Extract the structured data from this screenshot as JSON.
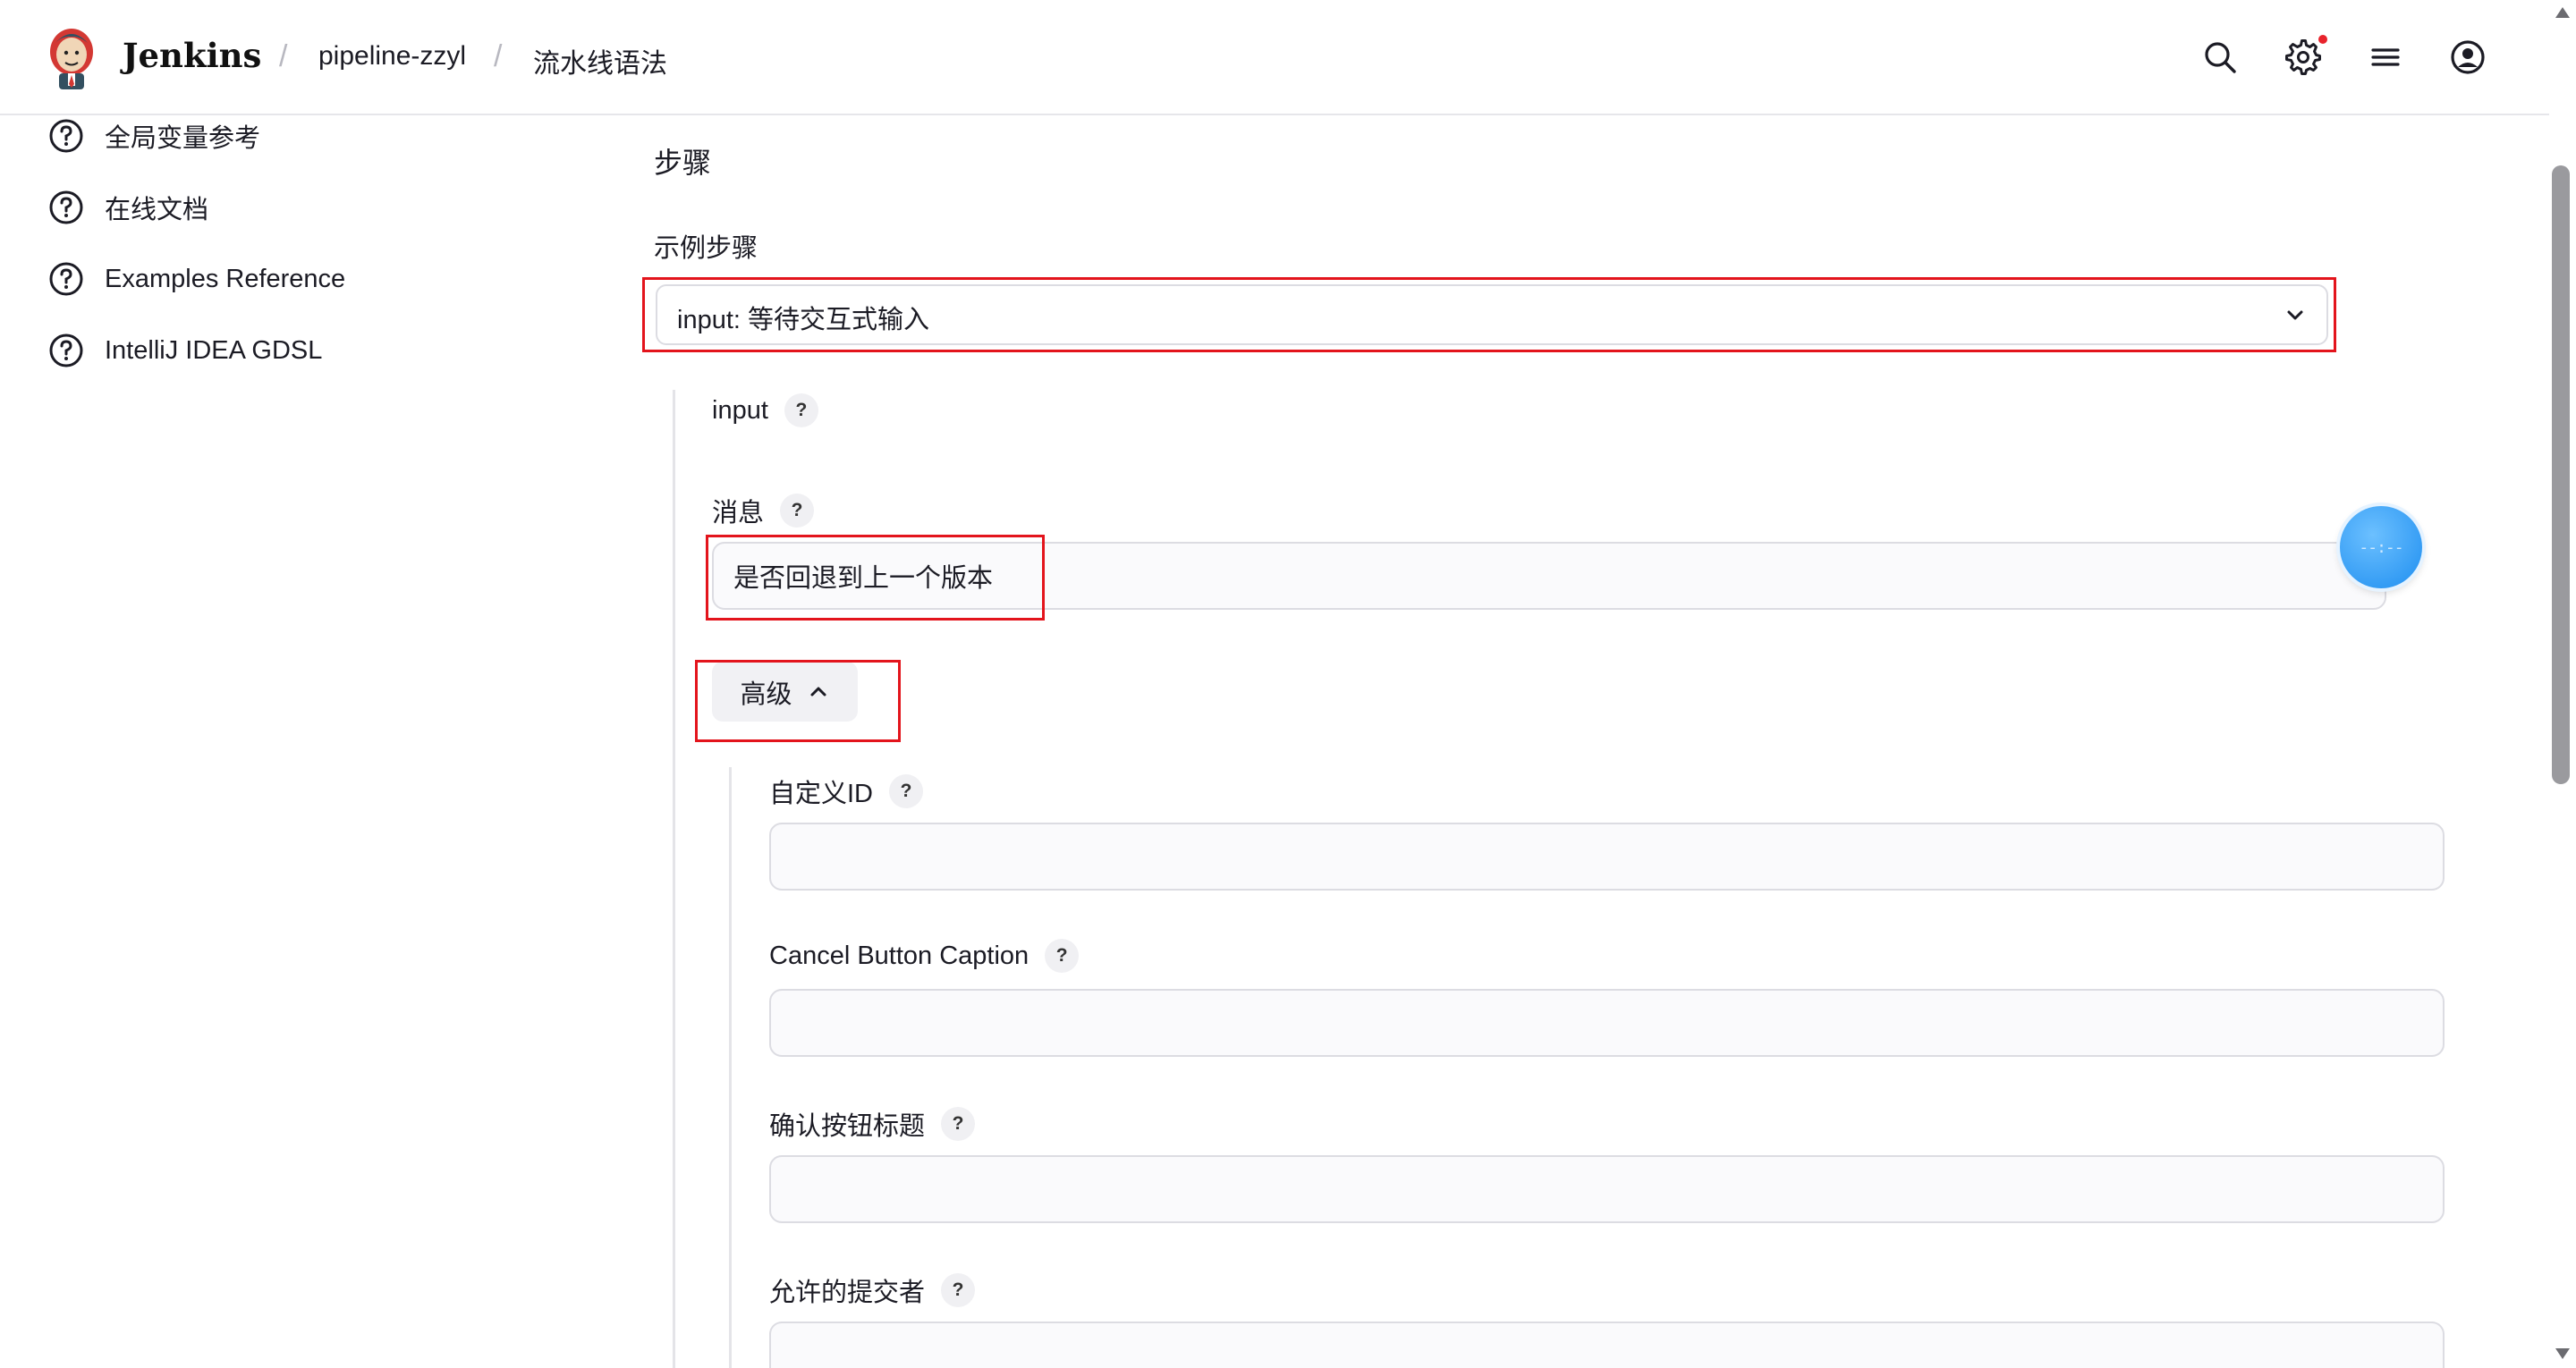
{
  "header": {
    "brand": "Jenkins",
    "breadcrumbs": [
      "pipeline-zzyl",
      "流水线语法"
    ],
    "icons": [
      "search-icon",
      "gear-icon",
      "menu-icon",
      "account-icon"
    ],
    "notification_dot_color": "#e8232c"
  },
  "sidebar": {
    "items": [
      {
        "label": "全局变量参考",
        "icon": "help-circle-icon"
      },
      {
        "label": "在线文档",
        "icon": "help-circle-icon"
      },
      {
        "label": "Examples Reference",
        "icon": "help-circle-icon"
      },
      {
        "label": "IntelliJ IDEA GDSL",
        "icon": "help-circle-icon"
      }
    ]
  },
  "main": {
    "section_title": "步骤",
    "sample_step": {
      "label": "示例步骤",
      "selected": "input: 等待交互式输入"
    },
    "step_name": "input",
    "message": {
      "label": "消息",
      "value": "是否回退到上一个版本"
    },
    "advanced_label": "高级",
    "advanced_fields": {
      "custom_id": {
        "label": "自定义ID",
        "value": ""
      },
      "cancel_caption": {
        "label": "Cancel Button Caption",
        "value": ""
      },
      "ok_caption": {
        "label": "确认按钮标题",
        "value": ""
      },
      "submitter": {
        "label": "允许的提交者",
        "value": ""
      }
    },
    "help_glyph": "?",
    "float_button_text": "--:--"
  },
  "colors": {
    "highlight_border": "#e3141c",
    "float_button": "#1e8ef0"
  }
}
